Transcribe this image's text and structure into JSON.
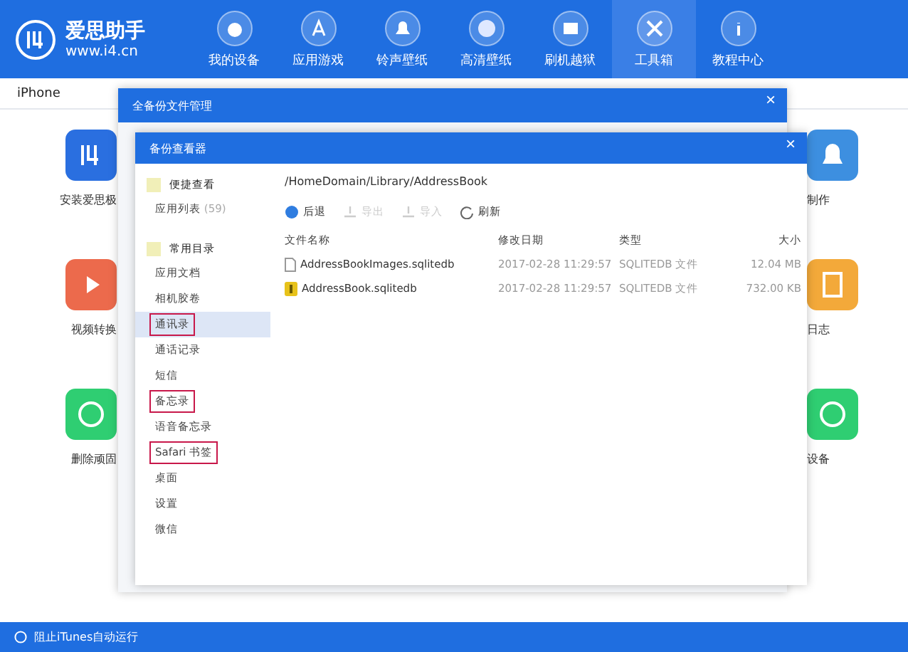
{
  "app": {
    "name": "爱思助手",
    "url": "www.i4.cn"
  },
  "nav": [
    {
      "label": "我的设备",
      "selected": false
    },
    {
      "label": "应用游戏",
      "selected": false
    },
    {
      "label": "铃声壁纸",
      "selected": false
    },
    {
      "label": "高清壁纸",
      "selected": false
    },
    {
      "label": "刷机越狱",
      "selected": false
    },
    {
      "label": "工具箱",
      "selected": true
    },
    {
      "label": "教程中心",
      "selected": false
    }
  ],
  "device_tab": "iPhone",
  "tools_left": [
    {
      "label": "安装爱思极",
      "color": "#2a6fe0"
    },
    {
      "label": "视频转换",
      "color": "#ec6a4c"
    },
    {
      "label": "删除顽固",
      "color": "#2fce72"
    }
  ],
  "tools_right": [
    {
      "label": "制作",
      "color": "#3d8fe0"
    },
    {
      "label": "日志",
      "color": "#f3a93a"
    },
    {
      "label": "设备",
      "color": "#2fce72"
    }
  ],
  "status_bar": {
    "label": "阻止iTunes自动运行"
  },
  "outer_dialog": {
    "title": "全备份文件管理",
    "close": "×"
  },
  "viewer": {
    "title": "备份查看器",
    "close": "×",
    "sections": [
      {
        "label": "便捷查看",
        "items": [
          {
            "label": "应用列表",
            "count": "(59)",
            "selected": false,
            "marked": false
          }
        ]
      },
      {
        "label": "常用目录",
        "items": [
          {
            "label": "应用文档",
            "selected": false,
            "marked": false
          },
          {
            "label": "相机胶卷",
            "selected": false,
            "marked": false
          },
          {
            "label": "通讯录",
            "selected": true,
            "marked": true
          },
          {
            "label": "通话记录",
            "selected": false,
            "marked": false
          },
          {
            "label": "短信",
            "selected": false,
            "marked": false
          },
          {
            "label": "备忘录",
            "selected": false,
            "marked": true
          },
          {
            "label": "语音备忘录",
            "selected": false,
            "marked": false
          },
          {
            "label": "Safari 书签",
            "selected": false,
            "marked": true
          },
          {
            "label": "桌面",
            "selected": false,
            "marked": false
          },
          {
            "label": "设置",
            "selected": false,
            "marked": false
          },
          {
            "label": "微信",
            "selected": false,
            "marked": false
          }
        ]
      }
    ],
    "path": "/HomeDomain/Library/AddressBook",
    "toolbar": [
      {
        "label": "后退",
        "disabled": false
      },
      {
        "label": "导出",
        "disabled": true
      },
      {
        "label": "导入",
        "disabled": true
      },
      {
        "label": "刷新",
        "disabled": false
      }
    ],
    "columns": [
      "文件名称",
      "修改日期",
      "类型",
      "大小"
    ],
    "rows": [
      {
        "name": "AddressBookImages.sqlitedb",
        "date": "2017-02-28 11:29:57",
        "type": "SQLITEDB 文件",
        "size": "12.04 MB",
        "kind": "file"
      },
      {
        "name": "AddressBook.sqlitedb",
        "date": "2017-02-28 11:29:57",
        "type": "SQLITEDB 文件",
        "size": "732.00 KB",
        "kind": "db"
      }
    ]
  }
}
